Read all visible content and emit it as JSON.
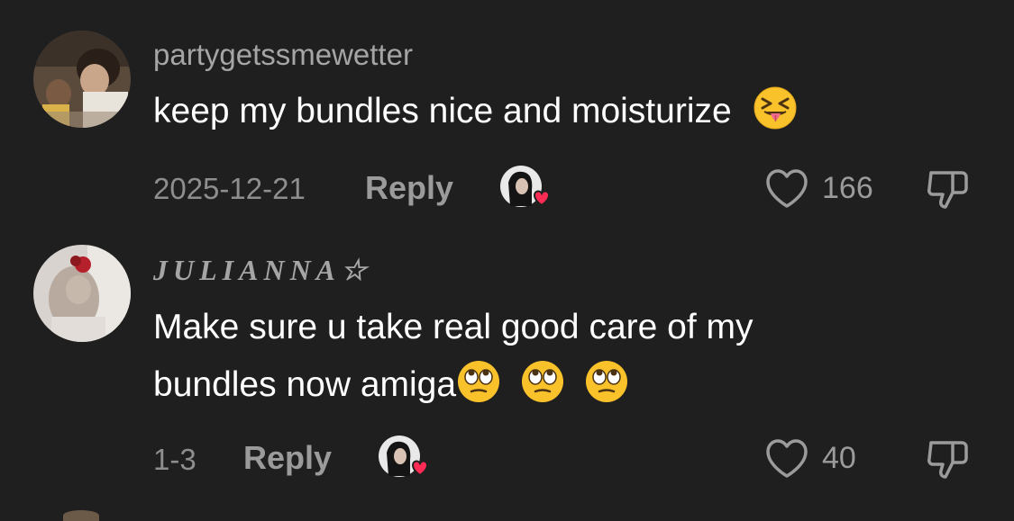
{
  "comments": [
    {
      "username": "partygetssmewetter",
      "text_lines": [
        "keep my bundles nice and moisturize"
      ],
      "emoji": "squinting-face-with-tongue",
      "date": "2025-12-21",
      "reply_label": "Reply",
      "likes": "166"
    },
    {
      "username": "JULIANNA☆",
      "text_lines": [
        "Make sure u take real good care of my",
        "bundles now amiga"
      ],
      "emoji": "face-with-rolling-eyes",
      "date": "1-3",
      "reply_label": "Reply",
      "likes": "40"
    }
  ],
  "colors": {
    "background": "#1f1f1f",
    "username": "#a5a5a5",
    "text": "#ffffff",
    "meta": "#8e8e8e",
    "heart_badge": "#fe2c55"
  }
}
